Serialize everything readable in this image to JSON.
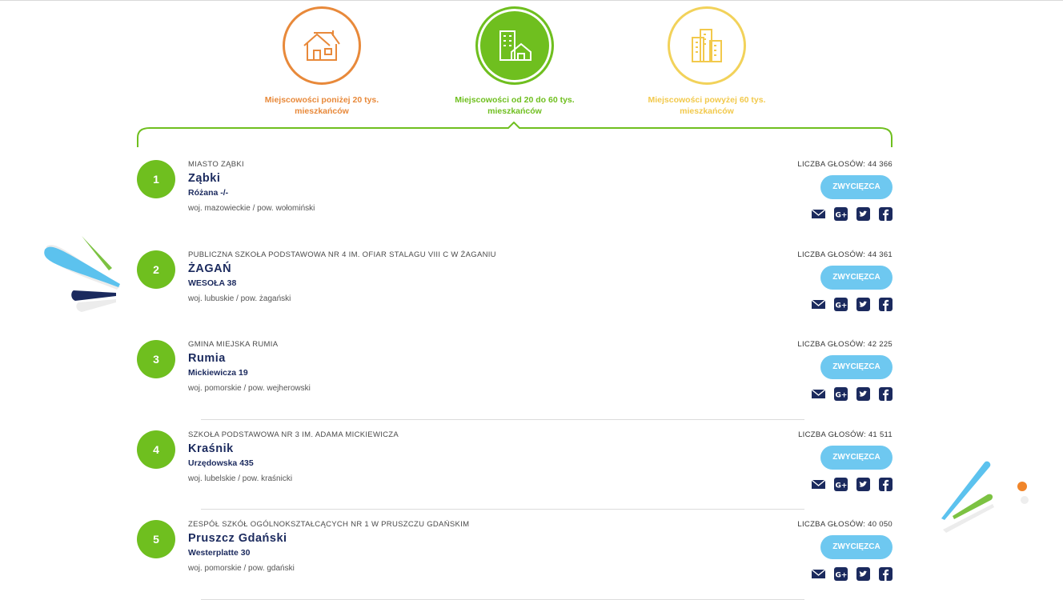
{
  "colors": {
    "orange": "#e8893a",
    "green": "#6fbf1f",
    "yellow": "#f2d25a",
    "navy": "#1b2a5e",
    "button": "#6ec8f0"
  },
  "tabs": [
    {
      "label_line1": "Miejscowości poniżej 20 tys.",
      "label_line2": "mieszkańców",
      "icon": "house-icon",
      "active": false
    },
    {
      "label_line1": "Miejscowości od 20 do 60 tys.",
      "label_line2": "mieszkańców",
      "icon": "building-icon",
      "active": true
    },
    {
      "label_line1": "Miejscowości powyżej 60 tys.",
      "label_line2": "mieszkańców",
      "icon": "skyscrapers-icon",
      "active": false
    }
  ],
  "votes_label": "LICZBA GŁOSÓW:",
  "button_label": "ZWYCIĘZCA",
  "rows": [
    {
      "rank": "1",
      "institution": "MIASTO ZĄBKI",
      "city": "Ząbki",
      "street": "Różana -/-",
      "region": "woj. mazowieckie / pow. wołomiński",
      "votes": "44 366"
    },
    {
      "rank": "2",
      "institution": "PUBLICZNA SZKOŁA PODSTAWOWA NR 4 IM. OFIAR STALAGU VIII C W ŻAGANIU",
      "city": "ŻAGAŃ",
      "street": "WESOŁA 38",
      "region": "woj. lubuskie / pow. żagański",
      "votes": "44 361"
    },
    {
      "rank": "3",
      "institution": "GMINA MIEJSKA RUMIA",
      "city": "Rumia",
      "street": "Mickiewicza 19",
      "region": "woj. pomorskie / pow. wejherowski",
      "votes": "42 225"
    },
    {
      "rank": "4",
      "institution": "SZKOŁA PODSTAWOWA NR 3 IM. ADAMA MICKIEWICZA",
      "city": "Kraśnik",
      "street": "Urzędowska 435",
      "region": "woj. lubelskie / pow. kraśnicki",
      "votes": "41 511"
    },
    {
      "rank": "5",
      "institution": "ZESPÓŁ SZKÓŁ OGÓLNOKSZTAŁCĄCYCH NR 1 W PRUSZCZU GDAŃSKIM",
      "city": "Pruszcz Gdański",
      "street": "Westerplatte 30",
      "region": "woj. pomorskie / pow. gdański",
      "votes": "40 050"
    }
  ]
}
